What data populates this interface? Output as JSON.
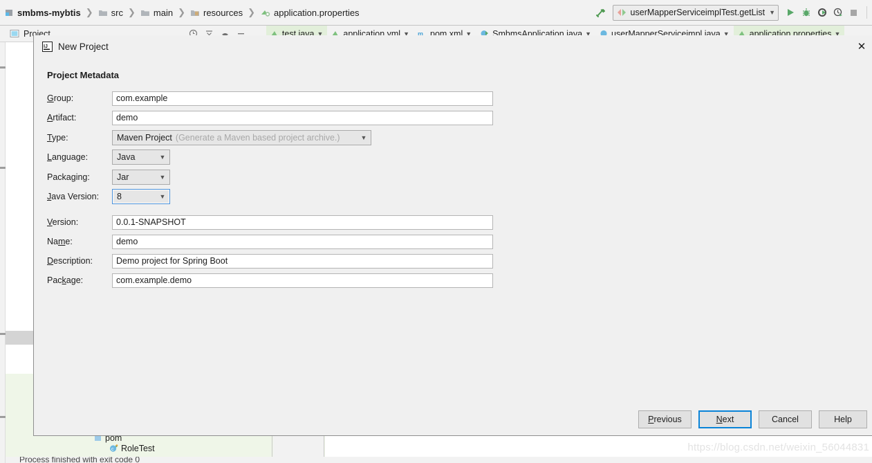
{
  "ide": {
    "breadcrumb": [
      {
        "label": "smbms-mybtis",
        "icon": "module-icon"
      },
      {
        "label": "src",
        "icon": "folder-icon"
      },
      {
        "label": "main",
        "icon": "folder-icon"
      },
      {
        "label": "resources",
        "icon": "resources-folder-icon"
      },
      {
        "label": "application.properties",
        "icon": "properties-file-icon"
      }
    ],
    "toolbar": {
      "build_icon": "hammer-icon",
      "run_configuration": "userMapperServiceimplTest.getList",
      "run_icon": "run-icon",
      "debug_icon": "debug-icon",
      "coverage_icon": "run-with-coverage-icon",
      "profile_icon": "profiler-icon",
      "stop_icon": "stop-icon"
    },
    "toolwindow": {
      "label": "Project"
    },
    "editor_tabs": [
      {
        "label": "test.java",
        "active": true
      },
      {
        "label": "application.yml",
        "active": false
      },
      {
        "label": "pom.xml",
        "active": false
      },
      {
        "label": "SmbmsApplication.java",
        "active": false
      },
      {
        "label": "userMapperServiceimpl.java",
        "active": false
      },
      {
        "label": "application.properties",
        "active": true
      }
    ],
    "run_panel": {
      "node_pom": "pom",
      "node_roletest": "RoleTest",
      "status_text": "Process finished with exit code 0"
    },
    "watermark": "https://blog.csdn.net/weixin_56044831"
  },
  "dialog": {
    "title": "New Project",
    "icon": "intellij-idea-icon",
    "close_label": "✕",
    "section_title": "Project Metadata",
    "fields": [
      {
        "name": "group",
        "label": "Group:",
        "mnemonic": "G",
        "type": "text",
        "value": "com.example"
      },
      {
        "name": "artifact",
        "label": "Artifact:",
        "mnemonic": "A",
        "type": "text",
        "value": "demo"
      },
      {
        "name": "type",
        "label": "Type:",
        "mnemonic": "T",
        "type": "combo-wide",
        "value": "Maven Project",
        "hint": "(Generate a Maven based project archive.)"
      },
      {
        "name": "language",
        "label": "Language:",
        "mnemonic": "L",
        "type": "combo-narrow",
        "value": "Java"
      },
      {
        "name": "packaging",
        "label": "Packaging:",
        "mnemonic": "g",
        "type": "combo-narrow",
        "value": "Jar"
      },
      {
        "name": "java-version",
        "label": "Java Version:",
        "mnemonic": "J",
        "type": "combo-narrow",
        "value": "8",
        "focused": true
      },
      {
        "name": "version",
        "label": "Version:",
        "mnemonic": "V",
        "type": "text",
        "value": "0.0.1-SNAPSHOT"
      },
      {
        "name": "project-name",
        "label": "Name:",
        "mnemonic": "m",
        "type": "text",
        "value": "demo"
      },
      {
        "name": "description",
        "label": "Description:",
        "mnemonic": "D",
        "type": "text",
        "value": "Demo project for Spring Boot"
      },
      {
        "name": "package",
        "label": "Package:",
        "mnemonic": "k",
        "type": "text",
        "value": "com.example.demo"
      }
    ],
    "buttons": {
      "previous": "Previous",
      "next": "Next",
      "cancel": "Cancel",
      "help": "Help"
    }
  },
  "colors": {
    "dialog_bg": "#f0f0f0",
    "focus_blue": "#0a84d8",
    "field_border": "#b4b4b4",
    "combo_bg": "#e6e6e6",
    "hint_gray": "#a8a8a8",
    "active_tab_green": "#e2efda",
    "run_panel_green": "#eff6e8",
    "selection_gray": "#d4d4d4",
    "watermark_gray": "#e3e3e3"
  }
}
